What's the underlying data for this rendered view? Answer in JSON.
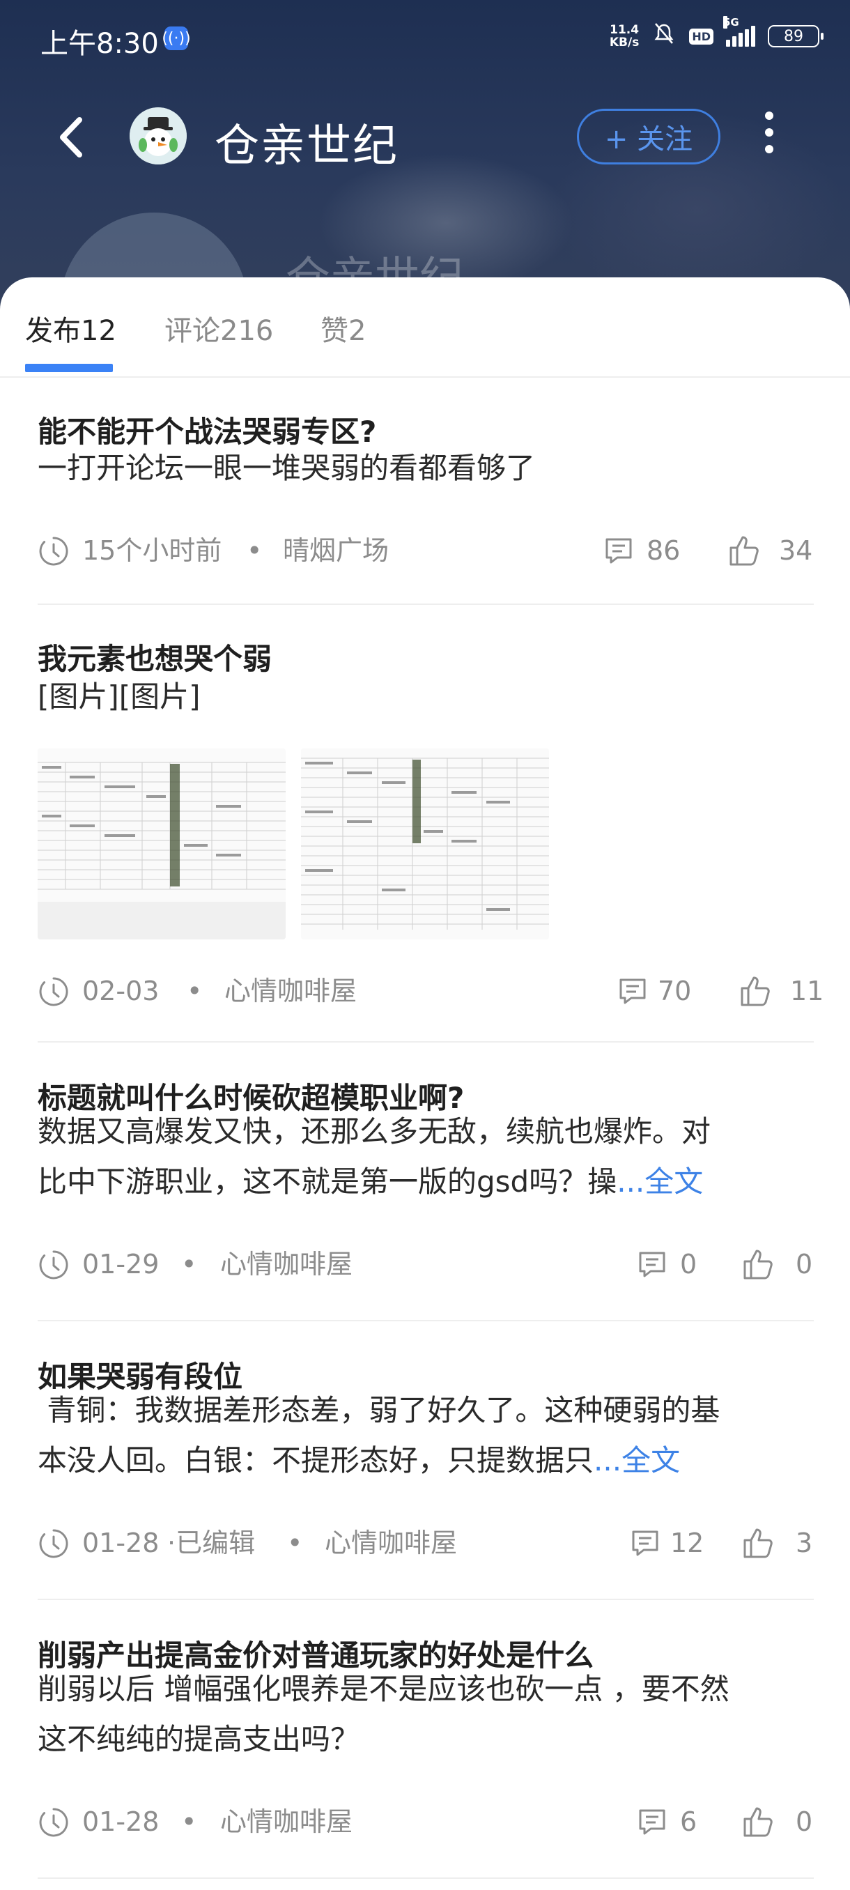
{
  "status": {
    "time": "上午8:30",
    "net_speed_value": "11.4",
    "net_speed_unit": "KB/s",
    "network": "5G",
    "hd": "HD",
    "battery": "89"
  },
  "header": {
    "back_icon": "chevron-left-icon",
    "title": "仓亲世纪",
    "follow_label": "+ 关注",
    "more_icon": "more-vertical-icon",
    "ghost_name": "仓亲世纪"
  },
  "tabs": [
    {
      "label": "发布12",
      "active": true
    },
    {
      "label": "评论216",
      "active": false
    },
    {
      "label": "赞2",
      "active": false
    }
  ],
  "colors": {
    "accent": "#3b82f6",
    "link": "#3d82e6",
    "header_bg": "#1e2f52"
  },
  "posts": [
    {
      "title": "能不能开个战法哭弱专区?",
      "body": "一打开论坛一眼一堆哭弱的看都看够了",
      "time": "15个小时前",
      "board": "晴烟广场",
      "comments": "86",
      "likes": "34"
    },
    {
      "title": "我元素也想哭个弱",
      "body": "[图片][图片]",
      "images": [
        "table-screenshot-1",
        "table-screenshot-2"
      ],
      "time": "02-03",
      "board": "心情咖啡屋",
      "comments": "70",
      "likes": "11"
    },
    {
      "title": "标题就叫什么时候砍超模职业啊?",
      "body_line1": "数据又高爆发又快，还那么多无敌，续航也爆炸。对",
      "body_line2": "比中下游职业，这不就是第一版的gsd吗？操",
      "more": "...全文",
      "time": "01-29",
      "board": "心情咖啡屋",
      "comments": "0",
      "likes": "0"
    },
    {
      "title": "如果哭弱有段位",
      "body_line1": " 青铜：我数据差形态差，弱了好久了。这种硬弱的基",
      "body_line2": "本没人回。白银：不提形态好，只提数据只",
      "more": "...全文",
      "time": "01-28",
      "edited": "·已编辑",
      "board": "心情咖啡屋",
      "comments": "12",
      "likes": "3"
    },
    {
      "title": "削弱产出提高金价对普通玩家的好处是什么",
      "body_line1": "削弱以后 增幅强化喂养是不是应该也砍一点 ，要不然",
      "body_line2": "这不纯纯的提高支出吗？",
      "time": "01-28",
      "board": "心情咖啡屋",
      "comments": "6",
      "likes": "0"
    }
  ]
}
